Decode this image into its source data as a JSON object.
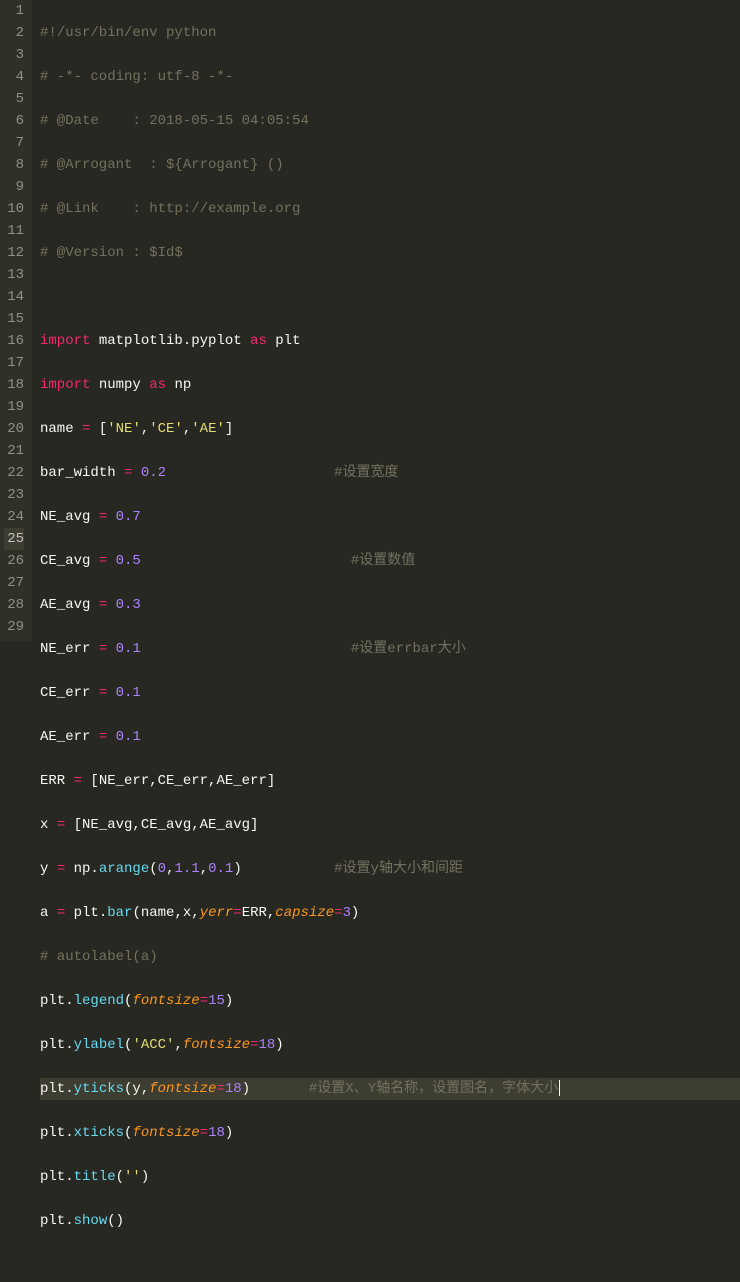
{
  "lines": {
    "l1": {
      "num": "1",
      "t1": "#!/usr/bin/env python"
    },
    "l2": {
      "num": "2",
      "t1": "# -*- coding: utf-8 -*-"
    },
    "l3": {
      "num": "3",
      "t1": "# @Date    : 2018-05-15 04:05:54"
    },
    "l4": {
      "num": "4",
      "t1": "# @Arrogant  : ${Arrogant} ()"
    },
    "l5": {
      "num": "5",
      "t1": "# @Link    : http://example.org"
    },
    "l6": {
      "num": "6",
      "t1": "# @Version : $Id$"
    },
    "l7": {
      "num": "7"
    },
    "l8": {
      "num": "8",
      "t1": "import",
      "t2": " matplotlib.pyplot ",
      "t3": "as",
      "t4": " plt"
    },
    "l9": {
      "num": "9",
      "t1": "import",
      "t2": " numpy ",
      "t3": "as",
      "t4": " np"
    },
    "l10": {
      "num": "10",
      "t1": "name ",
      "t2": "=",
      "t3": " [",
      "t4": "'NE'",
      "t5": ",",
      "t6": "'CE'",
      "t7": ",",
      "t8": "'AE'",
      "t9": "]"
    },
    "l11": {
      "num": "11",
      "t1": "bar_width ",
      "t2": "=",
      "t3": " ",
      "t4": "0.2",
      "pad": "                    ",
      "t5": "#设置宽度"
    },
    "l12": {
      "num": "12",
      "t1": "NE_avg ",
      "t2": "=",
      "t3": " ",
      "t4": "0.7"
    },
    "l13": {
      "num": "13",
      "t1": "CE_avg ",
      "t2": "=",
      "t3": " ",
      "t4": "0.5",
      "pad": "                         ",
      "t5": "#设置数值"
    },
    "l14": {
      "num": "14",
      "t1": "AE_avg ",
      "t2": "=",
      "t3": " ",
      "t4": "0.3"
    },
    "l15": {
      "num": "15",
      "t1": "NE_err ",
      "t2": "=",
      "t3": " ",
      "t4": "0.1",
      "pad": "                         ",
      "t5": "#设置errbar大小"
    },
    "l16": {
      "num": "16",
      "t1": "CE_err ",
      "t2": "=",
      "t3": " ",
      "t4": "0.1"
    },
    "l17": {
      "num": "17",
      "t1": "AE_err ",
      "t2": "=",
      "t3": " ",
      "t4": "0.1"
    },
    "l18": {
      "num": "18",
      "t1": "ERR ",
      "t2": "=",
      "t3": " [NE_err,CE_err,AE_err]"
    },
    "l19": {
      "num": "19",
      "t1": "x ",
      "t2": "=",
      "t3": " [NE_avg,CE_avg,AE_avg]"
    },
    "l20": {
      "num": "20",
      "t1": "y ",
      "t2": "=",
      "t3": " np.",
      "t4": "arange",
      "t5": "(",
      "t6": "0",
      "t7": ",",
      "t8": "1.1",
      "t9": ",",
      "t10": "0.1",
      "t11": ")",
      "pad": "           ",
      "t12": "#设置y轴大小和间距"
    },
    "l21": {
      "num": "21",
      "t1": "a ",
      "t2": "=",
      "t3": " plt.",
      "t4": "bar",
      "t5": "(name,x,",
      "t6": "yerr",
      "t7": "=",
      "t8": "ERR,",
      "t9": "capsize",
      "t10": "=",
      "t11": "3",
      "t12": ")"
    },
    "l22": {
      "num": "22",
      "t1": "# autolabel(a)"
    },
    "l23": {
      "num": "23",
      "t1": "plt.",
      "t2": "legend",
      "t3": "(",
      "t4": "fontsize",
      "t5": "=",
      "t6": "15",
      "t7": ")"
    },
    "l24": {
      "num": "24",
      "t1": "plt.",
      "t2": "ylabel",
      "t3": "(",
      "t4": "'ACC'",
      "t5": ",",
      "t6": "fontsize",
      "t7": "=",
      "t8": "18",
      "t9": ")"
    },
    "l25": {
      "num": "25",
      "t1": "plt.",
      "t2": "yticks",
      "t3": "(y,",
      "t4": "fontsize",
      "t5": "=",
      "t6": "18",
      "t7": ")",
      "pad": "       ",
      "t8": "#设置X、Y轴名称，设置图名，字体大小"
    },
    "l26": {
      "num": "26",
      "t1": "plt.",
      "t2": "xticks",
      "t3": "(",
      "t4": "fontsize",
      "t5": "=",
      "t6": "18",
      "t7": ")"
    },
    "l27": {
      "num": "27",
      "t1": "plt.",
      "t2": "title",
      "t3": "(",
      "t4": "''",
      "t5": ")"
    },
    "l28": {
      "num": "28",
      "t1": "plt.",
      "t2": "show",
      "t3": "()"
    },
    "l29": {
      "num": "29"
    }
  }
}
